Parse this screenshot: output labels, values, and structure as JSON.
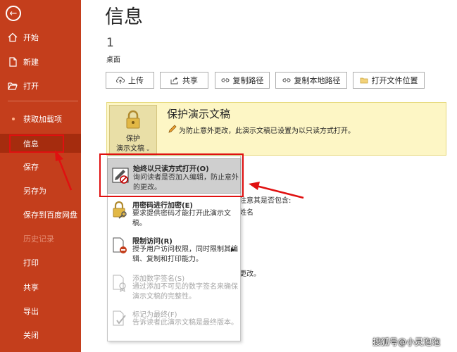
{
  "sidebar": {
    "back_icon": "back-arrow-icon",
    "items": [
      {
        "label": "开始",
        "icon": "home-icon"
      },
      {
        "label": "新建",
        "icon": "new-document-icon"
      },
      {
        "label": "打开",
        "icon": "folder-open-icon"
      },
      {
        "label": "获取加载项"
      },
      {
        "label": "信息"
      },
      {
        "label": "保存"
      },
      {
        "label": "另存为"
      },
      {
        "label": "保存到百度网盘"
      },
      {
        "label": "历史记录"
      },
      {
        "label": "打印"
      },
      {
        "label": "共享"
      },
      {
        "label": "导出"
      },
      {
        "label": "关闭"
      }
    ]
  },
  "main": {
    "title": "信息",
    "count": "1",
    "location": "桌面",
    "buttons": [
      {
        "label": "上传",
        "icon": "upload-cloud-icon"
      },
      {
        "label": "共享",
        "icon": "share-icon"
      },
      {
        "label": "复制路径",
        "icon": "link-icon"
      },
      {
        "label": "复制本地路径",
        "icon": "link-icon"
      },
      {
        "label": "打开文件位置",
        "icon": "folder-icon"
      }
    ],
    "protect": {
      "button_line1": "保护",
      "button_line2": "演示文稿",
      "title": "保护演示文稿",
      "desc": "为防止意外更改，此演示文稿已设置为以只读方式打开。"
    },
    "background_text": {
      "fragment1": "注意其是否包含:",
      "fragment2": "姓名",
      "fragment3": "更改。"
    }
  },
  "menu": {
    "items": [
      {
        "title": "始终以只读方式打开(O)",
        "desc": "询问读者是否加入编辑，防止意外的更改。",
        "icon": "read-only-pencil-icon"
      },
      {
        "title": "用密码进行加密(E)",
        "desc": "要求提供密码才能打开此演示文稿。",
        "icon": "lock-key-icon"
      },
      {
        "title": "限制访问(R)",
        "desc": "授予用户访问权限，同时限制其编辑、复制和打印能力。",
        "icon": "restrict-access-icon"
      },
      {
        "title": "添加数字签名(S)",
        "desc": "通过添加不可见的数字签名来确保演示文稿的完整性。",
        "icon": "digital-signature-icon"
      },
      {
        "title": "标记为最终(F)",
        "desc": "告诉读者此演示文稿是最终版本。",
        "icon": "mark-final-icon"
      }
    ]
  },
  "watermark": "搜狐号@小灵泡泡",
  "colors": {
    "sidebar": "#c43e1c",
    "highlight": "#e01010",
    "protect_panel": "#fdf6c5"
  }
}
